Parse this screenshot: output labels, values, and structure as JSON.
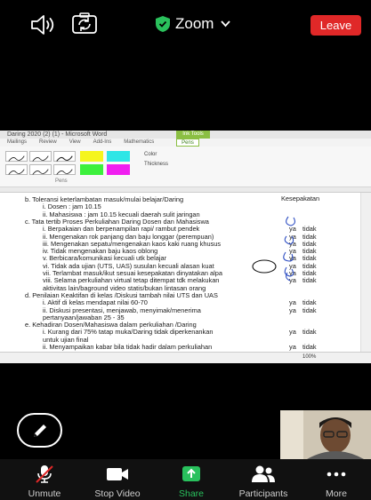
{
  "topbar": {
    "title": "Zoom",
    "leave_label": "Leave",
    "icons": [
      "speaker-icon",
      "camera-switch-icon",
      "shield-check-icon",
      "chevron-down-icon"
    ],
    "colors": {
      "leave": "#e02828",
      "shield": "#2ac15c"
    }
  },
  "word": {
    "window_title": "Daring  2020 (2) (1) - Microsoft Word",
    "context_tab": "Ink Tools",
    "tabs": [
      "Mailings",
      "Review",
      "View",
      "Add-Ins",
      "Mathematics"
    ],
    "active_tab": "Pens",
    "ribbon": {
      "color_label": "Color",
      "thickness_label": "Thickness",
      "group_label": "Pens"
    },
    "highlighter_colors": [
      "#f5f51e",
      "#2ee6e6",
      "#f01ef0",
      "#3cf03c"
    ],
    "zoom_level": "100%"
  },
  "document": {
    "lines": [
      {
        "t": "b.     Toleransi keterlambatan masuk/mulai  belajar/Daring",
        "x": 28
      },
      {
        "t": "i.    Dosen           : jam 10.15",
        "x": 48
      },
      {
        "t": "ii.   Mahasiswa    : jam 10.15 kecuali daerah sulit jaringan",
        "x": 48
      },
      {
        "t": "c.     Tata tertib Proses Perkuliahan Daring Dosen dan Mahasiswa",
        "x": 28
      },
      {
        "t": "i.     Berpakaian dan berpenampilan rapi/ rambut pendek",
        "x": 48
      },
      {
        "t": "ii.    Mengenakan rok panjang dan baju longgar (perempuan)",
        "x": 48
      },
      {
        "t": "iii.   Mengenakan sepatu/mengenakan kaos kaki ruang khusus",
        "x": 48
      },
      {
        "t": "iv.    Tidak mengenakan baju kaos oblong",
        "x": 48
      },
      {
        "t": "v.     Berbicara/komunikasi kecuali utk belajar",
        "x": 48
      },
      {
        "t": "vi.    Tidak ada ujian (UTS, UAS) susulan kecuali alasan kuat",
        "x": 48
      },
      {
        "t": "vii.   Terlambat masuk/ikut sesuai kesepakatan dinyatakan alpa",
        "x": 48
      },
      {
        "t": "viii.  Selama perkuliahan virtual tetap ditempat tdk melakukan",
        "x": 48
      },
      {
        "t": "        aktivitas lain/baground video statis/bukan lintasan orang",
        "x": 48
      },
      {
        "t": "d.     Penilaian Keaktifan di kelas /Diskusi tambah nilai UTS dan UAS",
        "x": 28
      },
      {
        "t": "i.     Aktif di kelas mendapat nilai 60-70",
        "x": 48
      },
      {
        "t": "ii.    Diskusi presentasi, menjawab, menyimak/menerima",
        "x": 48
      },
      {
        "t": "        pertanyaan/jawaban  25 - 35",
        "x": 48
      },
      {
        "t": "e.     Kehadiran Dosen/Mahasiswa dalam perkuliahan /Daring",
        "x": 28
      },
      {
        "t": "i.     Kurang dari 75% tatap muka/Daring tidak diperkenankan",
        "x": 48
      },
      {
        "t": "        untuk ujian final",
        "x": 48
      },
      {
        "t": "ii.    Menyampaikan kabar bila tidak hadir dalam perkuliahan",
        "x": 48
      }
    ],
    "agreement_header": "Kesepakatan",
    "agreements": [
      {
        "row": 4,
        "ya": "ya",
        "tidak": "tidak"
      },
      {
        "row": 5,
        "ya": "ya",
        "tidak": "tidak"
      },
      {
        "row": 6,
        "ya": "ya",
        "tidak": "tidak"
      },
      {
        "row": 7,
        "ya": "ya",
        "tidak": "tidak"
      },
      {
        "row": 8,
        "ya": "ya",
        "tidak": "tidak"
      },
      {
        "row": 9,
        "ya": "ya",
        "tidak": "tidak"
      },
      {
        "row": 10,
        "ya": "ya",
        "tidak": "tidak"
      },
      {
        "row": 11,
        "ya": "ya",
        "tidak": "tidak"
      },
      {
        "row": 14,
        "ya": "ya",
        "tidak": "tidak"
      },
      {
        "row": 15,
        "ya": "ya",
        "tidak": "tidak"
      },
      {
        "row": 18,
        "ya": "ya",
        "tidak": "tidak"
      },
      {
        "row": 20,
        "ya": "ya",
        "tidak": "tidak"
      }
    ]
  },
  "toolbar": {
    "unmute": "Unmute",
    "stop_video": "Stop Video",
    "share": "Share",
    "participants": "Participants",
    "more": "More",
    "share_color": "#29c15d"
  }
}
